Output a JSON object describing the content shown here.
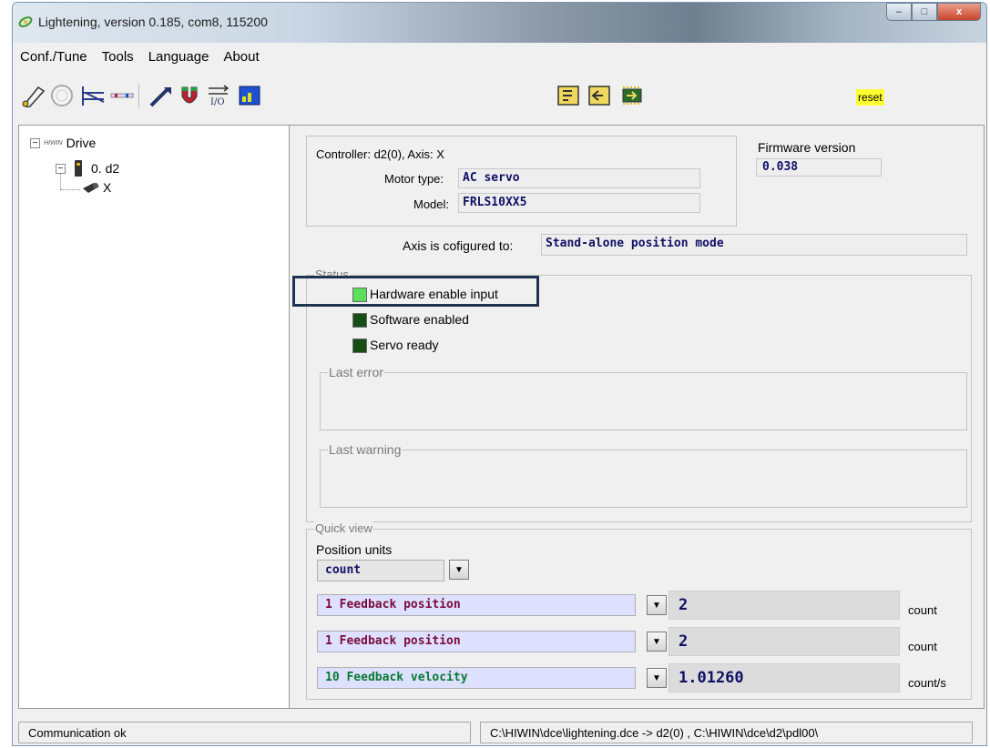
{
  "window": {
    "title": "Lightening, version 0.185, com8, 115200",
    "controls": {
      "minimize": "–",
      "maximize": "□",
      "close": "x"
    }
  },
  "menu": [
    "Conf./Tune",
    "Tools",
    "Language",
    "About"
  ],
  "toolbar": {
    "icons": [
      "probe-icon",
      "dial-gauge-icon",
      "tuning-chart-icon",
      "io-bars-icon",
      "wand-icon",
      "magnet-icon",
      "io-icon",
      "scope-icon",
      "load-icon",
      "save-icon",
      "chip-icon"
    ],
    "reset_label": "reset"
  },
  "tree": {
    "root_label": "Drive",
    "brand": "HIWIN",
    "drive_label": "0. d2",
    "axis_label": "X"
  },
  "controller": {
    "info": "Controller: d2(0),  Axis: X",
    "motor_type_label": "Motor type:",
    "motor_type": "AC servo",
    "model_label": "Model:",
    "model": "FRLS10XX5",
    "firmware_label": "Firmware version",
    "firmware": "0.038"
  },
  "axis_config": {
    "label": "Axis is cofigured to:",
    "value": "Stand-alone position mode"
  },
  "status": {
    "legend": "Status",
    "items": [
      {
        "label": "Hardware enable input",
        "state": "on"
      },
      {
        "label": "Software enabled",
        "state": "off"
      },
      {
        "label": "Servo ready",
        "state": "off"
      }
    ],
    "last_error_legend": "Last error",
    "last_warning_legend": "Last warning"
  },
  "quick_view": {
    "legend": "Quick view",
    "position_units_label": "Position units",
    "position_units_value": "count",
    "rows": [
      {
        "signal": "1 Feedback position",
        "value": "2",
        "unit": "count"
      },
      {
        "signal": "1 Feedback position",
        "value": "2",
        "unit": "count"
      },
      {
        "signal": "10 Feedback velocity",
        "value": "1.01260",
        "unit": "count/s"
      }
    ]
  },
  "statusbar": {
    "left": "Communication ok",
    "right": "C:\\HIWIN\\dce\\lightening.dce -> d2(0) , C:\\HIWIN\\dce\\d2\\pdl00\\"
  },
  "colors": {
    "led_on": "#5ce05c",
    "led_off": "#154d15",
    "field_text": "#101065",
    "signal_red": "#7b0b3a",
    "signal_green": "#0a7a33",
    "highlight_border": "#1f3350",
    "reset_bg": "#ffff33"
  }
}
